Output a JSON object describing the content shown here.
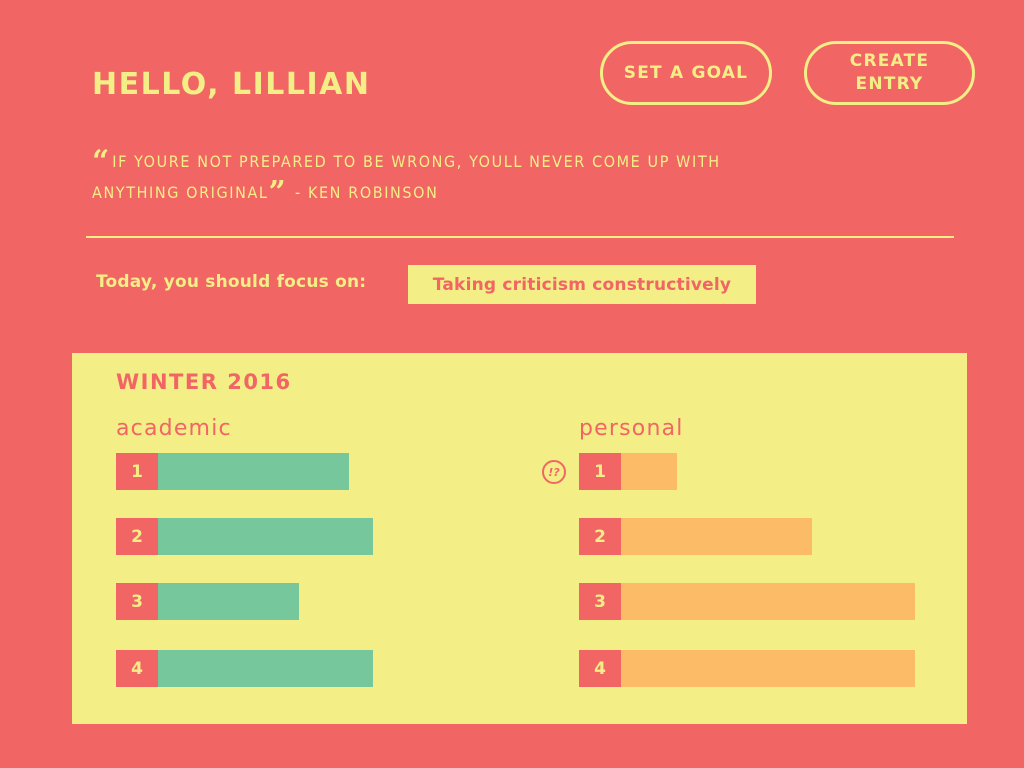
{
  "header": {
    "greeting": "HELLO, LILLIAN",
    "set_goal_label": "SET A GOAL",
    "create_entry_label": "CREATE\nENTRY"
  },
  "quote": {
    "open_mark": "“",
    "text": "IF YOURE NOT PREPARED TO BE WRONG, YOULL NEVER COME UP WITH ANYTHING ORIGINAL",
    "close_mark": "”",
    "attribution": "- KEN ROBINSON"
  },
  "focus": {
    "label": "Today, you should focus on:",
    "value": "Taking criticism constructively"
  },
  "panel": {
    "season": "WINTER 2016",
    "alert_icon_label": "!?"
  },
  "colors": {
    "background": "#F16565",
    "accent": "#F3EE86",
    "academic_bar": "#76C89C",
    "personal_bar": "#FCBB67"
  },
  "chart_data": [
    {
      "type": "bar",
      "title": "academic",
      "categories": [
        "1",
        "2",
        "3",
        "4"
      ],
      "values": [
        0.65,
        0.73,
        0.48,
        0.73
      ],
      "color": "#76C89C"
    },
    {
      "type": "bar",
      "title": "personal",
      "categories": [
        "1",
        "2",
        "3",
        "4"
      ],
      "values": [
        0.19,
        0.65,
        1.0,
        1.0
      ],
      "color": "#FCBB67"
    }
  ]
}
